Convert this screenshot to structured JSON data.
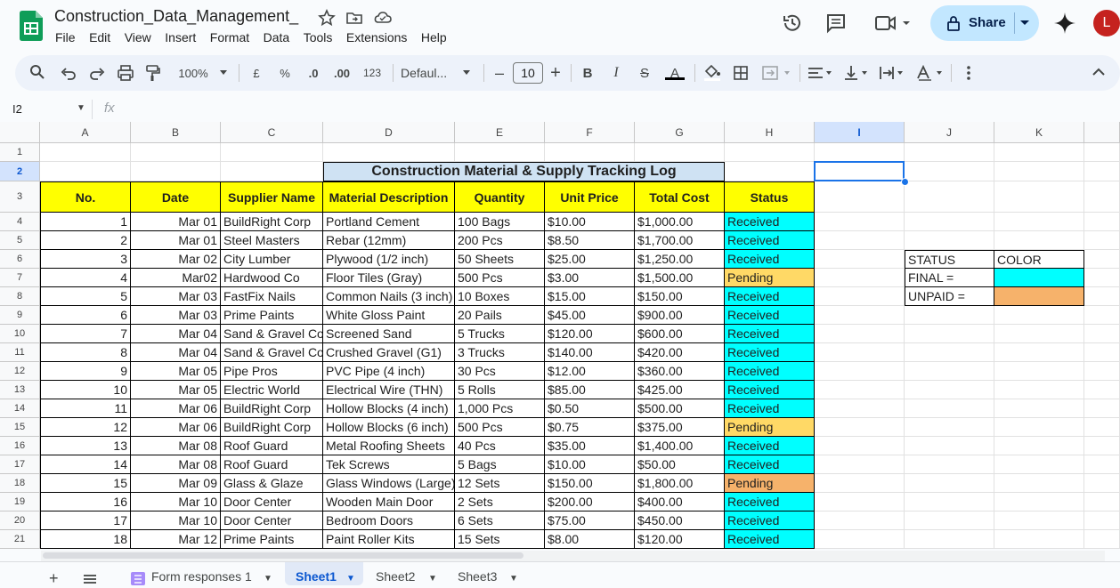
{
  "app": {
    "title": "Construction_Data_Management_",
    "menu": [
      "File",
      "Edit",
      "View",
      "Insert",
      "Format",
      "Data",
      "Tools",
      "Extensions",
      "Help"
    ],
    "share_label": "Share",
    "avatar_letter": "L"
  },
  "toolbar": {
    "zoom": "100%",
    "currency": "£",
    "percent": "%",
    "dec_decrease": ".0",
    "dec_increase": ".00",
    "number_format": "123",
    "font": "Defaul...",
    "font_size": "10",
    "bold": "B",
    "italic": "I",
    "strike": "S",
    "text_color": "A"
  },
  "formula_bar": {
    "name_box": "I2",
    "fx": "fx"
  },
  "columns": [
    "A",
    "B",
    "C",
    "D",
    "E",
    "F",
    "G",
    "H",
    "I",
    "J",
    "K"
  ],
  "rows": [
    "1",
    "2",
    "3",
    "4",
    "5",
    "6",
    "7",
    "8",
    "9",
    "10",
    "11",
    "12",
    "13",
    "14",
    "15",
    "16",
    "17",
    "18",
    "19",
    "20",
    "21"
  ],
  "sheet": {
    "title": "Construction Material & Supply Tracking Log",
    "headers": [
      "No.",
      "Date",
      "Supplier Name",
      "Material Description",
      "Quantity",
      "Unit Price",
      "Total Cost",
      "Status"
    ],
    "records": [
      [
        "1",
        "Mar 01",
        "BuildRight Corp",
        "Portland Cement",
        "100 Bags",
        "$10.00",
        "$1,000.00",
        "Received"
      ],
      [
        "2",
        "Mar 01",
        "Steel Masters",
        "Rebar (12mm)",
        "200 Pcs",
        "$8.50",
        "$1,700.00",
        "Received"
      ],
      [
        "3",
        "Mar 02",
        "City Lumber",
        "Plywood (1/2 inch)",
        "50 Sheets",
        "$25.00",
        "$1,250.00",
        "Received"
      ],
      [
        "4",
        "Mar02",
        "Hardwood Co",
        "Floor Tiles (Gray)",
        "500 Pcs",
        "$3.00",
        "$1,500.00",
        "Pending"
      ],
      [
        "5",
        "Mar 03",
        "FastFix Nails",
        "Common Nails (3 inch)",
        "10 Boxes",
        "$15.00",
        "$150.00",
        "Received"
      ],
      [
        "6",
        "Mar 03",
        "Prime Paints",
        "White Gloss Paint",
        "20 Pails",
        "$45.00",
        "$900.00",
        "Received"
      ],
      [
        "7",
        "Mar 04",
        "Sand & Gravel Co",
        "Screened Sand",
        "5 Trucks",
        "$120.00",
        "$600.00",
        "Received"
      ],
      [
        "8",
        "Mar 04",
        "Sand & Gravel Co",
        "Crushed Gravel (G1)",
        "3 Trucks",
        "$140.00",
        "$420.00",
        "Received"
      ],
      [
        "9",
        "Mar 05",
        "Pipe Pros",
        "PVC Pipe (4 inch)",
        "30 Pcs",
        "$12.00",
        "$360.00",
        "Received"
      ],
      [
        "10",
        "Mar 05",
        "Electric World",
        "Electrical Wire (THN)",
        "5 Rolls",
        "$85.00",
        "$425.00",
        "Received"
      ],
      [
        "11",
        "Mar 06",
        "BuildRight Corp",
        "Hollow Blocks (4 inch)",
        "1,000 Pcs",
        "$0.50",
        "$500.00",
        "Received"
      ],
      [
        "12",
        "Mar 06",
        "BuildRight Corp",
        "Hollow Blocks (6 inch)",
        "500 Pcs",
        "$0.75",
        "$375.00",
        "Pending"
      ],
      [
        "13",
        "Mar 08",
        "Roof Guard",
        "Metal Roofing Sheets",
        "40 Pcs",
        "$35.00",
        "$1,400.00",
        "Received"
      ],
      [
        "14",
        "Mar 08",
        "Roof Guard",
        "Tek Screws",
        "5 Bags",
        "$10.00",
        "$50.00",
        "Received"
      ],
      [
        "15",
        "Mar 09",
        "Glass & Glaze",
        "Glass Windows (Large)",
        "12 Sets",
        "$150.00",
        "$1,800.00",
        "Pending"
      ],
      [
        "16",
        "Mar 10",
        "Door Center",
        "Wooden Main Door",
        "2 Sets",
        "$200.00",
        "$400.00",
        "Received"
      ],
      [
        "17",
        "Mar 10",
        "Door Center",
        "Bedroom Doors",
        "6 Sets",
        "$75.00",
        "$450.00",
        "Received"
      ],
      [
        "18",
        "Mar 12",
        "Prime Paints",
        "Paint Roller Kits",
        "15 Sets",
        "$8.00",
        "$120.00",
        "Received"
      ]
    ],
    "legend": {
      "header": [
        "STATUS",
        "COLOR"
      ],
      "rows": [
        [
          "FINAL =",
          ""
        ],
        [
          "UNPAID =",
          ""
        ]
      ]
    }
  },
  "colors": {
    "received": "#00ffff",
    "pending": "#ffd966",
    "pending_alt": "#f6b26b",
    "header": "#ffff00",
    "title_bg": "#cfe2f3"
  },
  "tabs": [
    "Form responses 1",
    "Sheet1",
    "Sheet2",
    "Sheet3"
  ],
  "active_tab": "Sheet1"
}
